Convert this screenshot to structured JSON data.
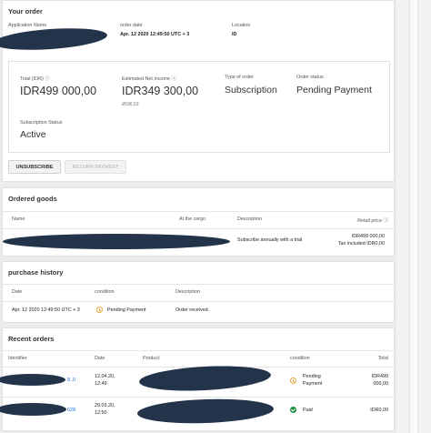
{
  "your_order": {
    "title": "Your order",
    "app_name_label": "Application Name",
    "order_date_label": "order date",
    "order_date_value": "Apr. 12 2020 12:49:50 UTC + 3",
    "location_label": "Location",
    "location_value": "ID",
    "total_label": "Total (IDR) ⓘ",
    "total_value": "IDR499 000,00",
    "net_income_label": "Estimated Net Income ⓘ",
    "net_income_value": "IDR349 300,00",
    "net_income_sub": "₽596,59",
    "type_label": "Type of order",
    "type_value": "Subscription",
    "status_label": "Order status",
    "status_value": "Pending Payment",
    "sub_status_label": "Subscription Status",
    "sub_status_value": "Active",
    "unsubscribe_button": "UNSUBSCRIBE",
    "return_payment_button": "RETURN PAYMENT"
  },
  "ordered_goods": {
    "title": "Ordered goods",
    "columns": [
      "Name",
      "At the cargo",
      "Description",
      "Retail price ⓘ"
    ],
    "row": {
      "description": "Subscribe annually with a trial",
      "price": "IDR499 000,00",
      "tax": "Tax included IDR0,00"
    }
  },
  "purchase_history": {
    "title": "purchase history",
    "columns": [
      "Date",
      "condition",
      "Description"
    ],
    "row": {
      "date": "Apr. 12 2020 12:49:50 UTC + 3",
      "condition": "Pending Payment",
      "description": "Order received."
    }
  },
  "recent_orders": {
    "title": "Recent orders",
    "columns": [
      "Identifier",
      "Date",
      "Product",
      "condition",
      "Total"
    ],
    "rows": [
      {
        "id_suffix": "8..0",
        "date_line1": "12.04.20,",
        "date_line2": "12:49",
        "condition_line1": "Pending",
        "condition_line2": "Payment",
        "total_line1": "IDR499",
        "total_line2": "000,00",
        "status_color": "#e8a33d"
      },
      {
        "id_suffix": "628",
        "date_line1": "29.03.20,",
        "date_line2": "12:50",
        "condition_line1": "Paid",
        "condition_line2": "",
        "total_line1": "IDR0,00",
        "total_line2": "",
        "status_color": "#1e8e3e"
      }
    ]
  },
  "icons": {
    "pending": "clock-icon",
    "paid": "check-circle-icon"
  }
}
